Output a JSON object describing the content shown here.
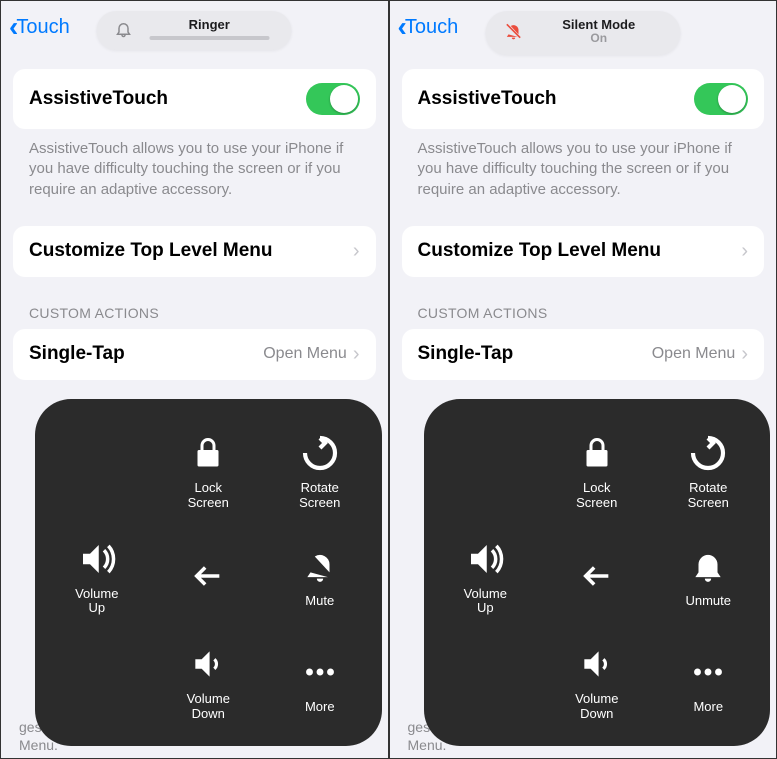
{
  "left": {
    "nav": {
      "back": "Touch"
    },
    "pill": {
      "title": "Ringer"
    },
    "assistive": {
      "title": "AssistiveTouch"
    },
    "footer": "AssistiveTouch allows you to use your iPhone if you have difficulty touching the screen or if you require an adaptive accessory.",
    "customize": "Customize Top Level Menu",
    "section": "CUSTOM ACTIONS",
    "row": {
      "label": "Single-Tap",
      "value": "Open Menu"
    },
    "bottom": "gestures that can be activated from Custom in the Menu.",
    "panel": {
      "lock": "Lock\nScreen",
      "rotate": "Rotate\nScreen",
      "volup": "Volume\nUp",
      "mute": "Mute",
      "voldown": "Volume\nDown",
      "more": "More"
    }
  },
  "right": {
    "nav": {
      "back": "Touch"
    },
    "pill": {
      "title": "Silent Mode",
      "sub": "On"
    },
    "assistive": {
      "title": "AssistiveTouch"
    },
    "footer": "AssistiveTouch allows you to use your iPhone if you have difficulty touching the screen or if you require an adaptive accessory.",
    "customize": "Customize Top Level Menu",
    "section": "CUSTOM ACTIONS",
    "row": {
      "label": "Single-Tap",
      "value": "Open Menu"
    },
    "bottom": "gestures that can be activated from Custom in the Menu.",
    "panel": {
      "lock": "Lock\nScreen",
      "rotate": "Rotate\nScreen",
      "volup": "Volume\nUp",
      "unmute": "Unmute",
      "voldown": "Volume\nDown",
      "more": "More"
    }
  }
}
